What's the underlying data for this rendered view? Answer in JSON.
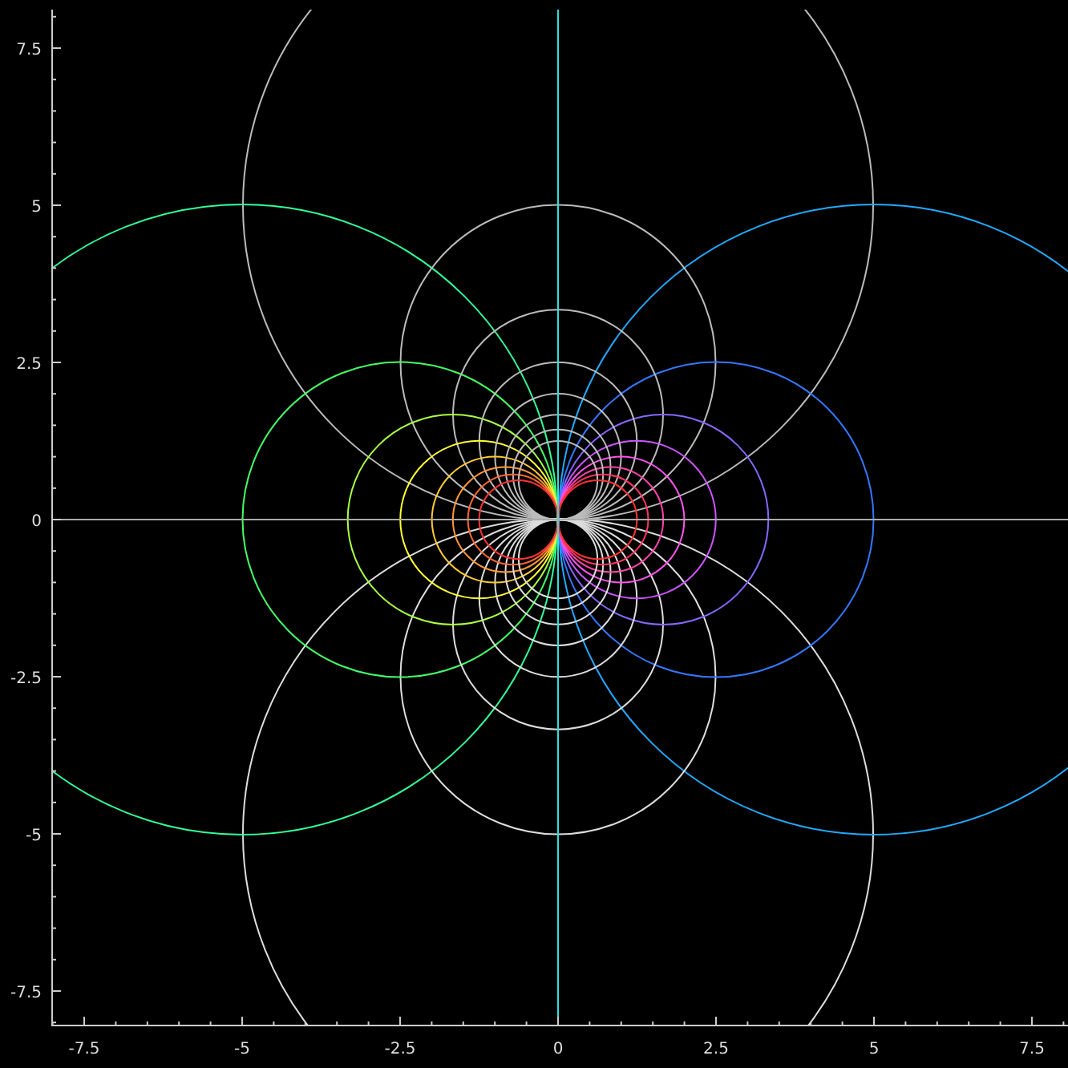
{
  "plot": {
    "x_tick_labels": [
      "-7.5",
      "-5",
      "-2.5",
      "0",
      "2.5",
      "5",
      "7.5"
    ],
    "y_tick_labels": [
      "7.5",
      "5",
      "2.5",
      "0",
      "-2.5",
      "-5",
      "-7.5"
    ]
  }
}
